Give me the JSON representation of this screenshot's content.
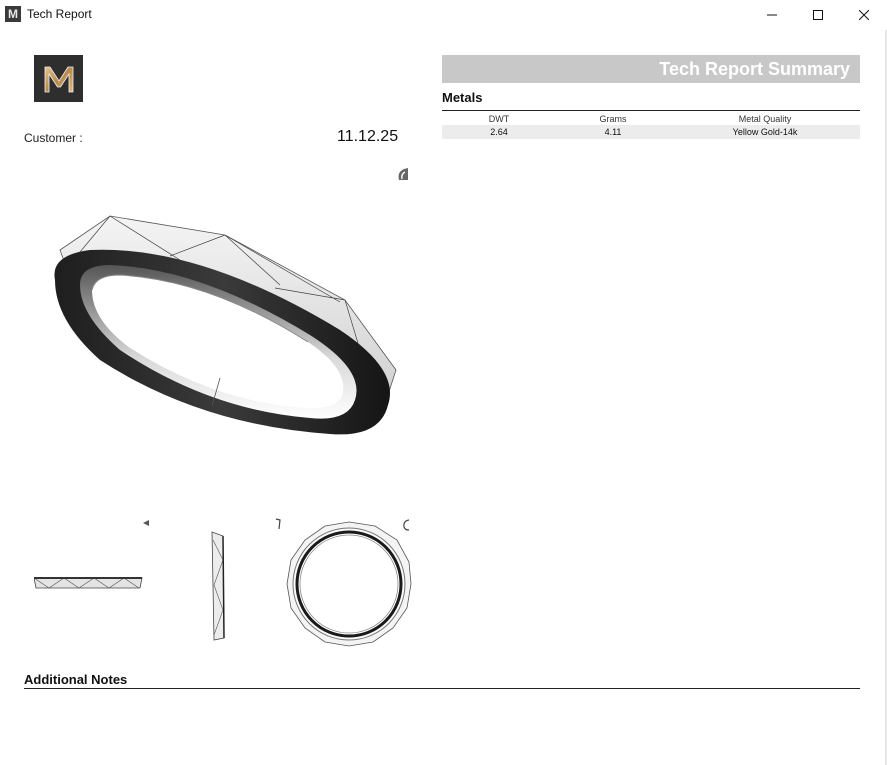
{
  "window": {
    "title": "Tech Report",
    "app_icon_letter": "M"
  },
  "report": {
    "customer_label": "Customer :",
    "date": "11.12.25"
  },
  "summary": {
    "title": "Tech Report Summary"
  },
  "metals": {
    "heading": "Metals",
    "columns": [
      "DWT",
      "Grams",
      "Metal Quality"
    ],
    "rows": [
      [
        "2.64",
        "4.11",
        "Yellow Gold-14k"
      ]
    ]
  },
  "notes": {
    "heading": "Additional Notes"
  },
  "colors": {
    "banner": "#c8c8c8",
    "logo_bg": "#2f2e2e",
    "logo_gold": "#c9a46a"
  }
}
